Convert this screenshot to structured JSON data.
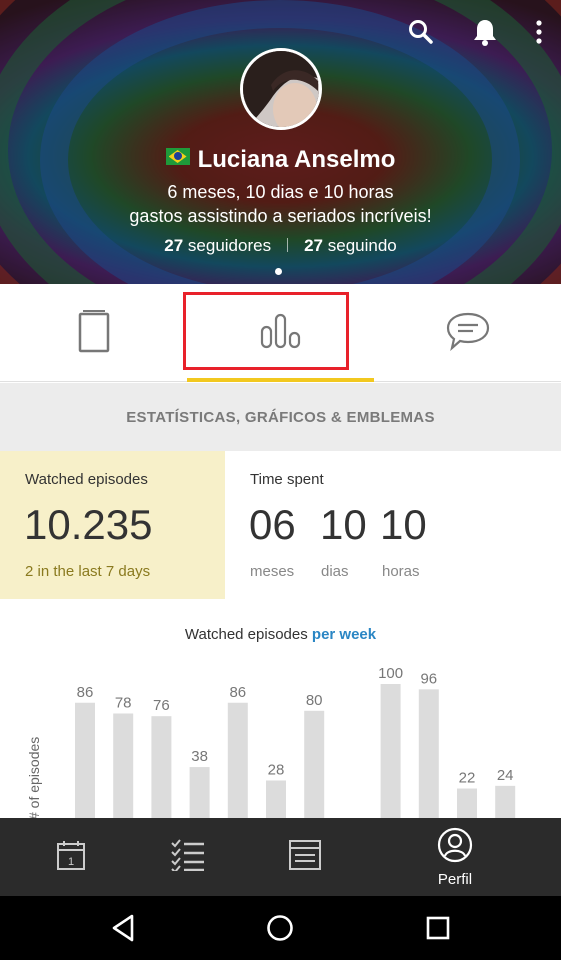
{
  "header": {
    "icons": [
      "search-icon",
      "bell-icon",
      "more-vertical-icon"
    ],
    "flag": "brazil-flag",
    "name": "Luciana Anselmo",
    "time_line1": "6 meses, 10 dias e 10 horas",
    "time_line2": "gastos assistindo a seriados incríveis!",
    "followers_count": "27",
    "followers_label": "seguidores",
    "following_count": "27",
    "following_label": "seguindo"
  },
  "tabs": [
    {
      "name": "shows",
      "icon": "phone-card-icon"
    },
    {
      "name": "stats",
      "icon": "bar-chart-icon",
      "active": true
    },
    {
      "name": "comments",
      "icon": "chat-bubble-icon"
    }
  ],
  "section_title": "ESTATÍSTICAS, GRÁFICOS & EMBLEMAS",
  "stats": {
    "watched_label": "Watched episodes",
    "watched_value": "10.235",
    "watched_sub": "2 in the last 7 days",
    "time_label": "Time spent",
    "time_values": [
      {
        "value": "06",
        "unit": "meses"
      },
      {
        "value": "10",
        "unit": "dias"
      },
      {
        "value": "10",
        "unit": "horas"
      }
    ]
  },
  "chart_title": {
    "prefix": "Watched episodes",
    "accent": "per week"
  },
  "chart_data": {
    "type": "bar",
    "ylabel": "# of episodes",
    "values": [
      86,
      78,
      76,
      38,
      86,
      28,
      80,
      null,
      100,
      96,
      22,
      24
    ]
  },
  "bottom_nav": [
    {
      "name": "calendar",
      "icon": "calendar-icon",
      "label": ""
    },
    {
      "name": "watchlist",
      "icon": "checklist-icon",
      "label": ""
    },
    {
      "name": "discover",
      "icon": "browser-window-icon",
      "label": ""
    },
    {
      "name": "profile",
      "icon": "profile-icon",
      "label": "Perfil",
      "active": true
    }
  ],
  "colors": {
    "accent_yellow": "#f2c81f",
    "highlight_red": "#e8212a",
    "link_blue": "#2a86c4",
    "stat_bg": "#f7f0c9",
    "stat_sub": "#8a7a1f",
    "nav_bg": "#2b2b2b",
    "bar_gray": "#dcdcdc"
  }
}
